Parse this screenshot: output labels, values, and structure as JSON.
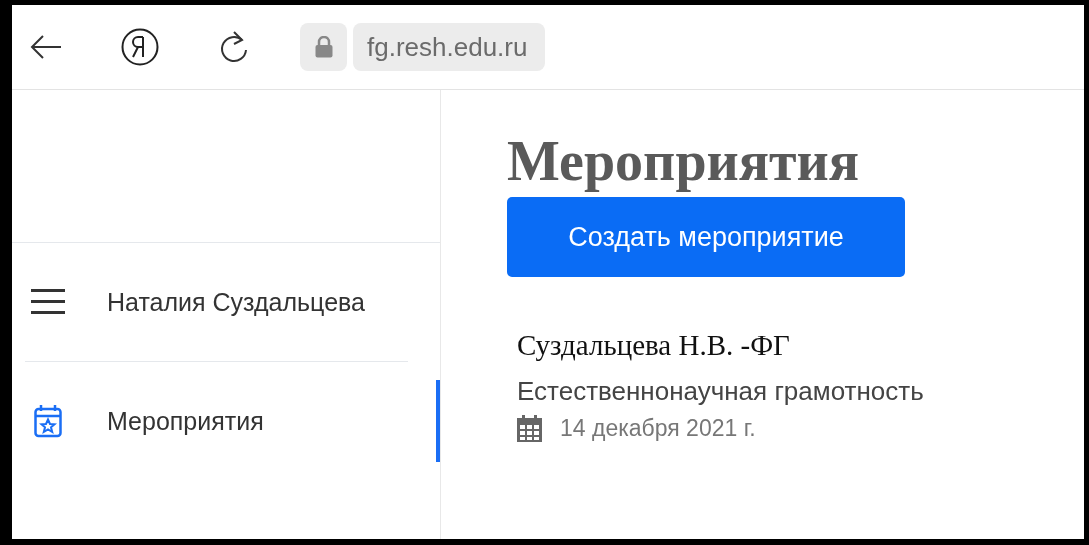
{
  "browser": {
    "url": "fg.resh.edu.ru"
  },
  "sidebar": {
    "items": [
      {
        "kind": "menu",
        "label": "Наталия Суздальцева",
        "selected": false
      },
      {
        "kind": "events",
        "label": "Мероприятия",
        "selected": true
      }
    ]
  },
  "page": {
    "title": "Мероприятия",
    "create_button": "Создать мероприятие"
  },
  "events": [
    {
      "title": "Суздальцева Н.В. -ФГ",
      "subject": "Естественнонаучная грамотность",
      "date": "14 декабря 2021 г."
    }
  ]
}
